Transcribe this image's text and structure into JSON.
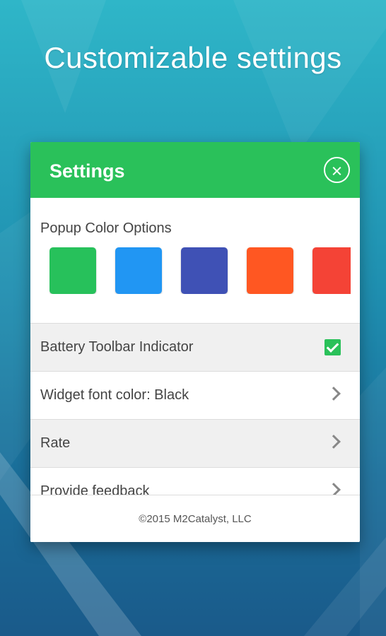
{
  "hero": {
    "title": "Customizable settings"
  },
  "dialog": {
    "title": "Settings",
    "close_icon": "close-circle-icon",
    "color_section": {
      "label": "Popup Color Options",
      "swatches": [
        "#27c15b",
        "#2196f3",
        "#3f51b5",
        "#ff5722",
        "#f44336"
      ]
    },
    "items": [
      {
        "label": "Battery Toolbar Indicator",
        "control": "checkbox",
        "checked": true
      },
      {
        "label": "Widget font color: Black",
        "control": "chevron"
      },
      {
        "label": "Rate",
        "control": "chevron"
      },
      {
        "label": "Provide feedback",
        "control": "chevron"
      }
    ],
    "footer": "©2015 M2Catalyst, LLC"
  },
  "colors": {
    "accent": "#2ac15a"
  }
}
